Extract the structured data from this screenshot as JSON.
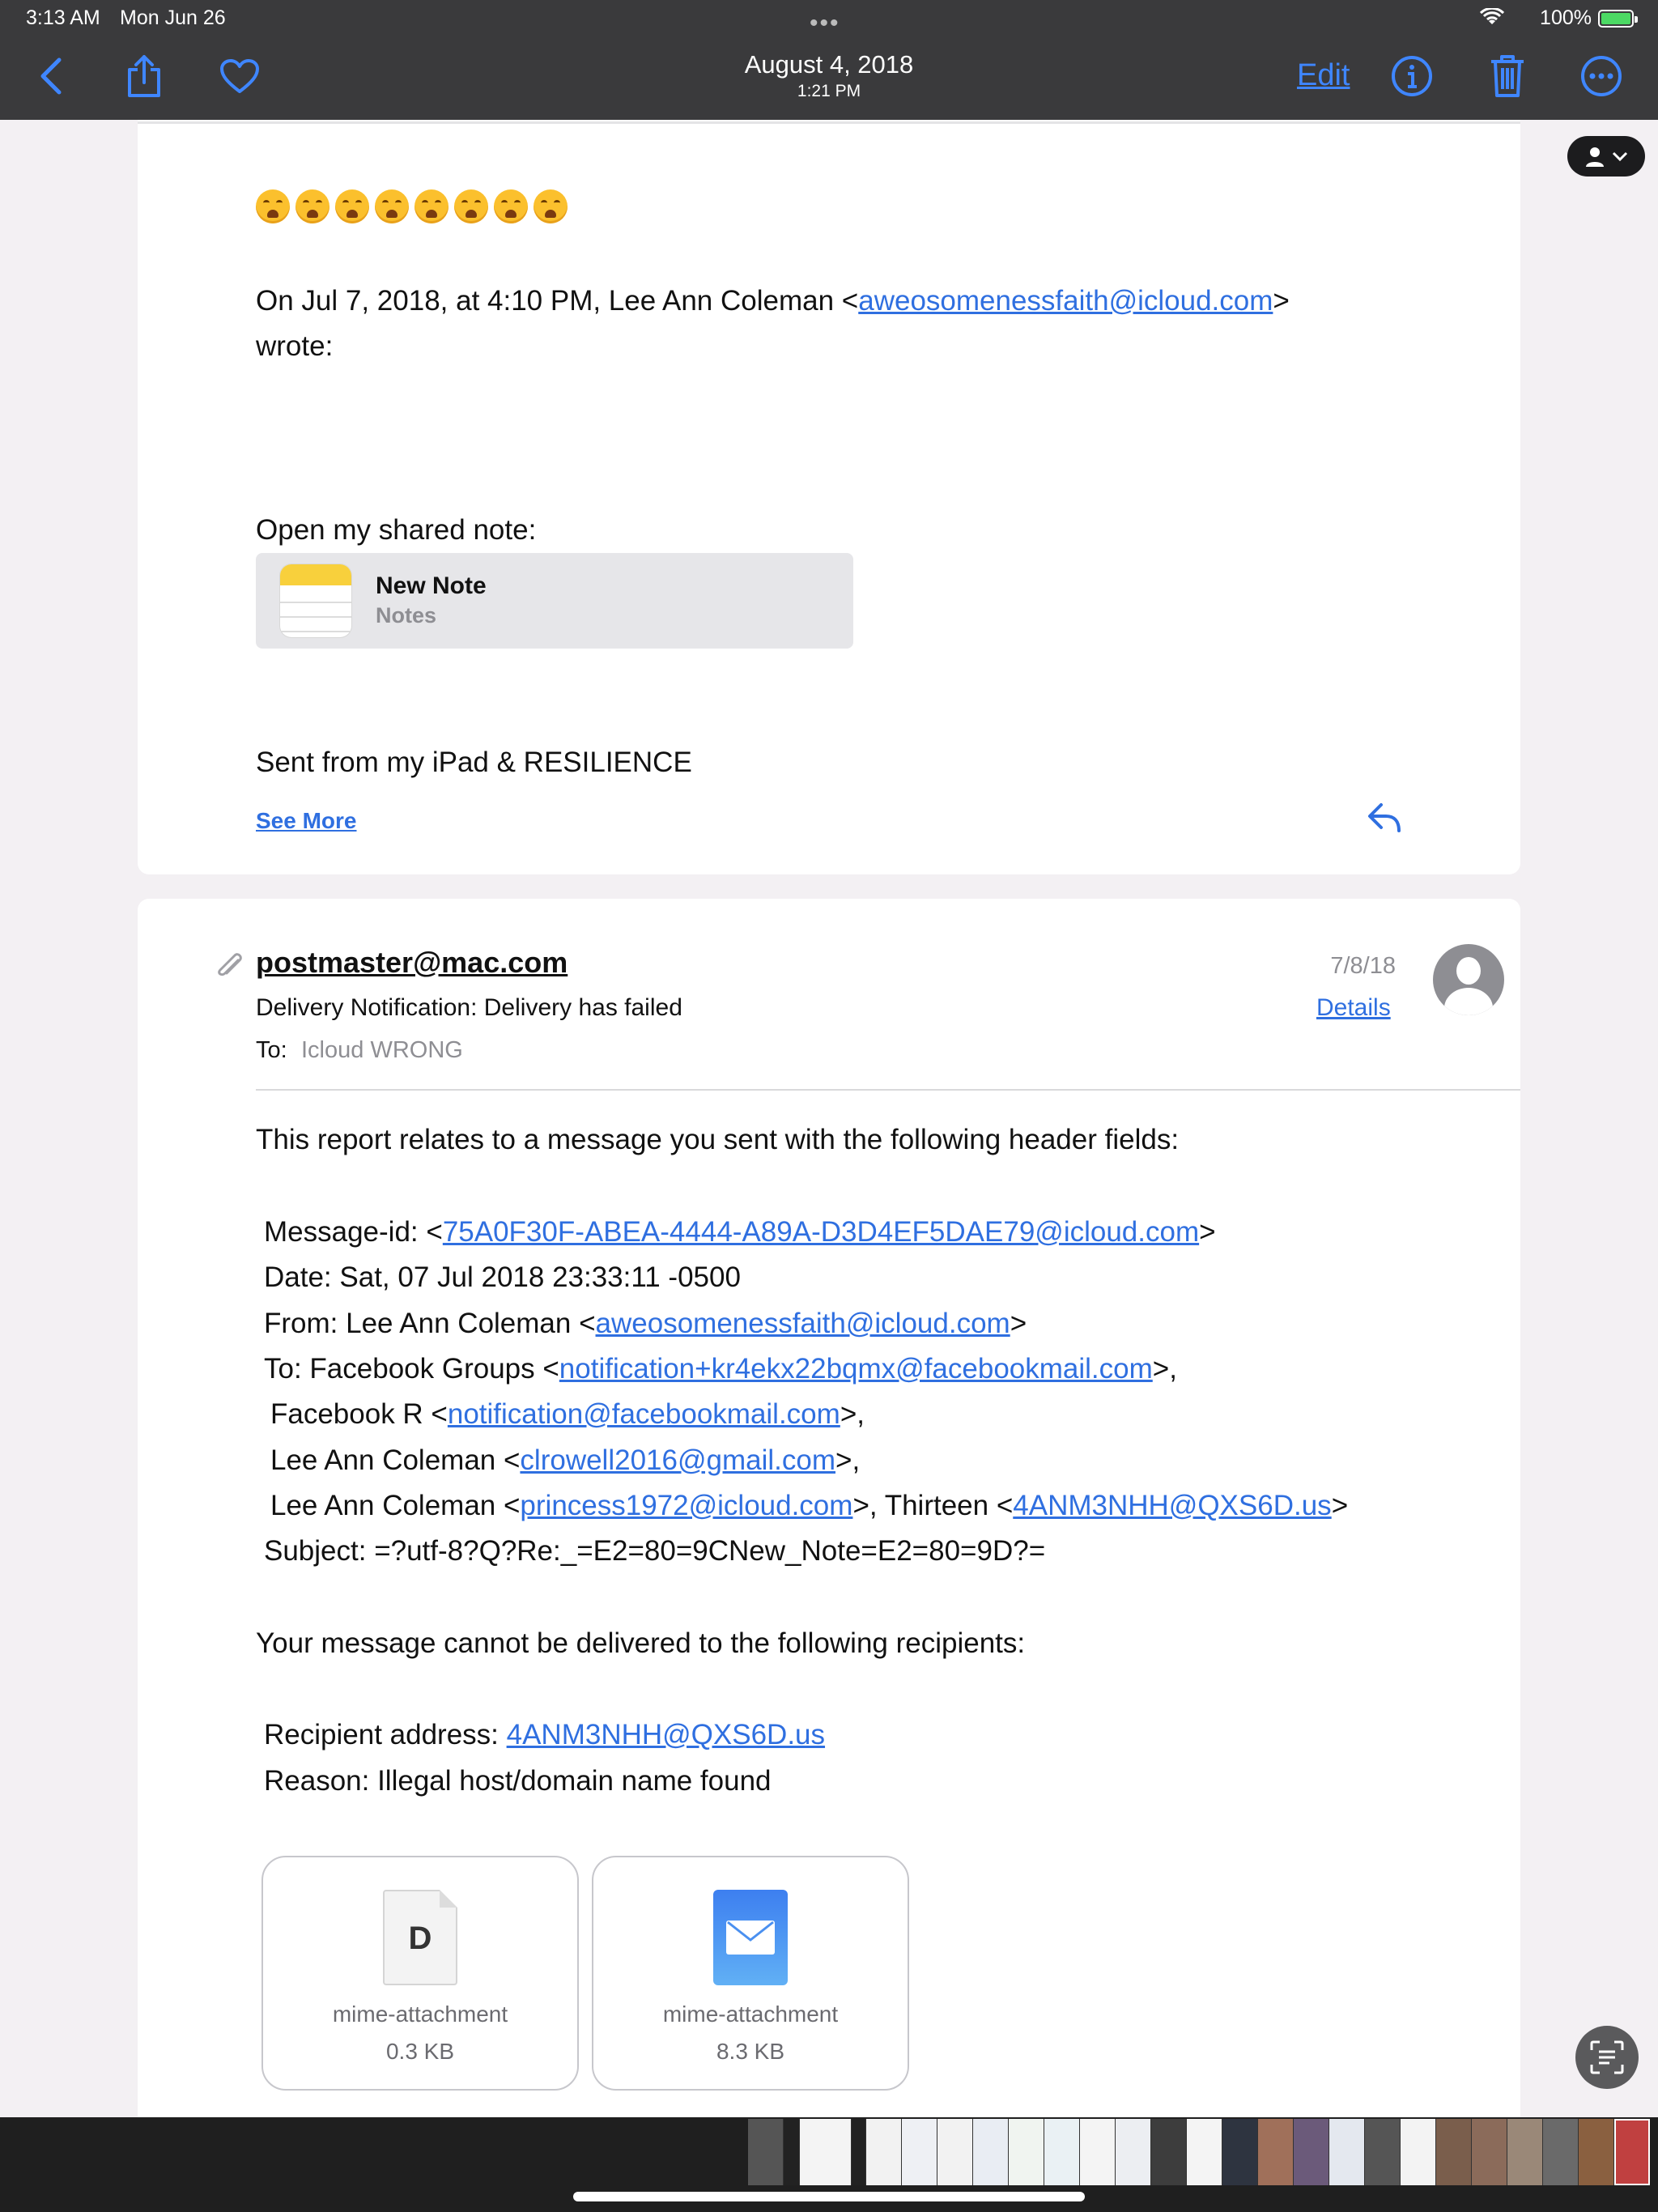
{
  "status": {
    "time": "3:13 AM",
    "day": "Mon Jun 26",
    "battery": "100%"
  },
  "toolbar": {
    "date": "August 4, 2018",
    "time": "1:21 PM",
    "edit_label": "Edit"
  },
  "message1": {
    "quote_header_prefix": "On Jul 7, 2018, at 4:10 PM, Lee Ann Coleman <",
    "quote_header_email": "aweosomenessfaith@icloud.com",
    "quote_header_suffix": ">",
    "wrote": "wrote:",
    "open_note": "Open my shared note:",
    "note_title": "New Note",
    "note_app": "Notes",
    "signature": "Sent from my iPad & RESILIENCE",
    "see_more": "See More"
  },
  "message2": {
    "sender": "postmaster@mac.com",
    "subject": "Delivery Notification: Delivery has failed",
    "to_label": "To:",
    "to_value": "Icloud WRONG",
    "date": "7/8/18",
    "details_label": "Details",
    "intro": "This report relates to a message you sent with the following header fields:",
    "msgid_label": "Message-id: <",
    "msgid_value": "75A0F30F-ABEA-4444-A89A-D3D4EF5DAE79@icloud.com",
    "date_line": "Date: Sat, 07 Jul 2018 23:33:11 -0500",
    "from_label": "From: Lee Ann Coleman <",
    "from_email": "aweosomenessfaith@icloud.com",
    "to_line_label": "To: Facebook Groups <",
    "to_line_email": "notification+kr4ekx22bqmx@facebookmail.com",
    "fbr_label": "Facebook R <",
    "fbr_email": "notification@facebookmail.com",
    "lac1_label": "Lee Ann Coleman <",
    "lac1_email": "clrowell2016@gmail.com",
    "lac2_label": "Lee Ann Coleman <",
    "lac2_email": "princess1972@icloud.com",
    "thirteen_label": ">, Thirteen <",
    "thirteen_email": "4ANM3NHH@QXS6D.us",
    "subject_line": "Subject: =?utf-8?Q?Re:_=E2=80=9CNew_Note=E2=80=9D?=",
    "cannot_deliver": "Your message cannot be delivered to the following recipients:",
    "recipient_label": "Recipient address: ",
    "recipient_email": "4ANM3NHH@QXS6D.us",
    "reason": "Reason: Illegal host/domain name found"
  },
  "attachments": [
    {
      "name": "mime-attachment",
      "size": "0.3 KB",
      "icon": "document-icon",
      "letter": "D"
    },
    {
      "name": "mime-attachment",
      "size": "8.3 KB",
      "icon": "mail-icon"
    }
  ],
  "colors": {
    "link": "#2f6fe0",
    "toolbar_bg": "#3a3a3c",
    "accent": "#3f86ff"
  }
}
